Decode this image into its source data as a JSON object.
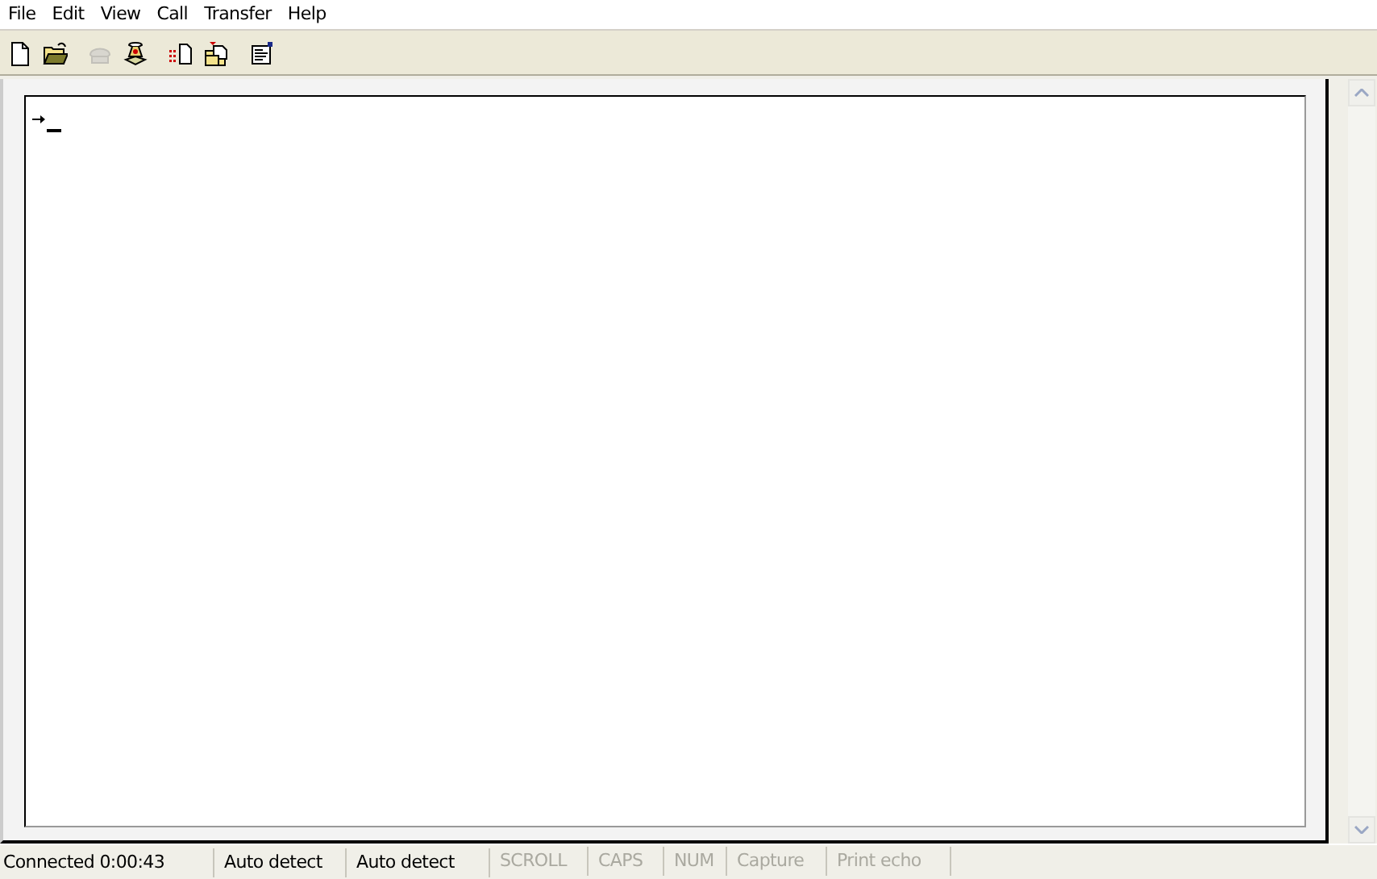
{
  "menu": [
    "File",
    "Edit",
    "View",
    "Call",
    "Transfer",
    "Help"
  ],
  "toolbar": [
    [
      {
        "kind": "new",
        "disabled": false
      },
      {
        "kind": "open",
        "disabled": false
      }
    ],
    [
      {
        "kind": "phone",
        "disabled": true
      },
      {
        "kind": "dial",
        "disabled": false
      }
    ],
    [
      {
        "kind": "send",
        "disabled": false
      },
      {
        "kind": "receive",
        "disabled": false
      }
    ],
    [
      {
        "kind": "properties",
        "disabled": false
      }
    ]
  ],
  "status_bar": [
    {
      "text": "Connected 0:00:43",
      "disabled": false
    },
    {
      "text": "Auto detect",
      "disabled": false
    },
    {
      "text": "Auto detect",
      "disabled": false
    },
    {
      "text": "SCROLL",
      "disabled": true
    },
    {
      "text": "CAPS",
      "disabled": true
    },
    {
      "text": "NUM",
      "disabled": true
    },
    {
      "text": "Capture",
      "disabled": true
    },
    {
      "text": "Print echo",
      "disabled": true
    }
  ]
}
